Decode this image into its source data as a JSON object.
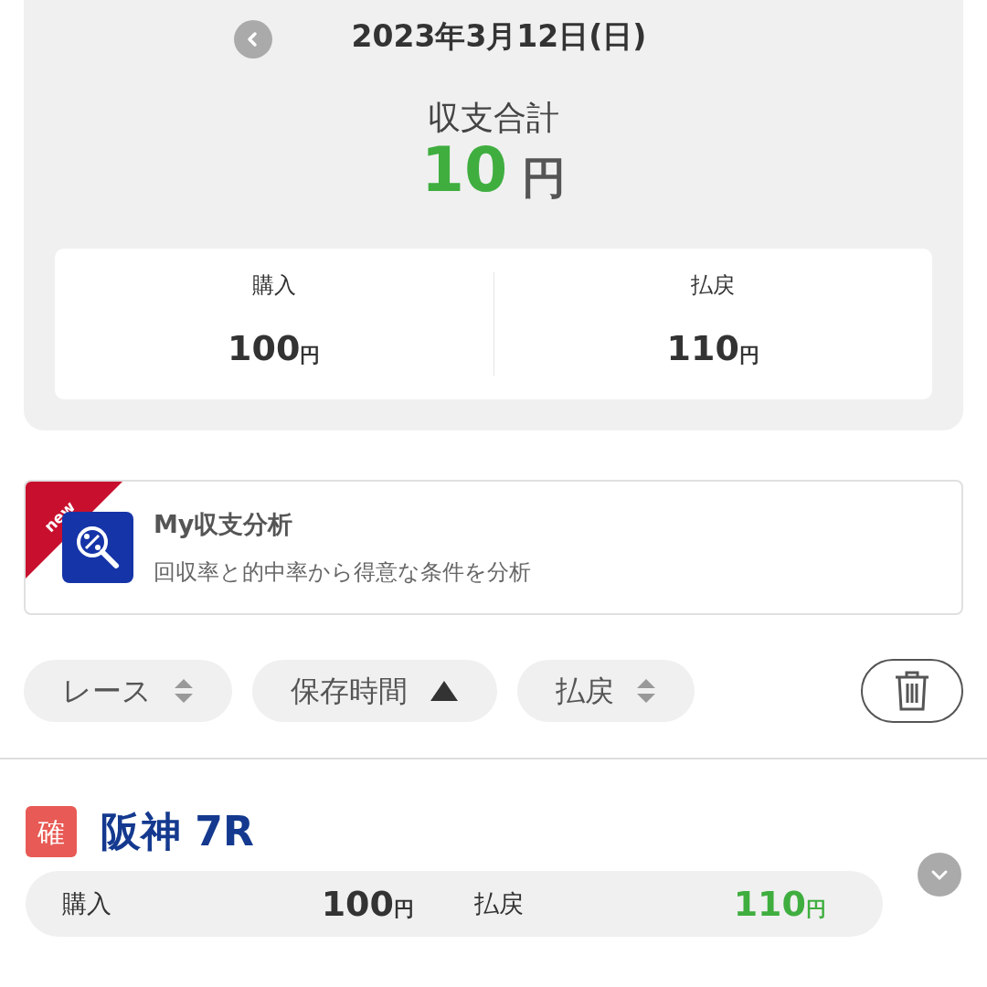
{
  "header": {
    "date": "2023年3月12日(日)"
  },
  "summary": {
    "label": "収支合計",
    "amount": "10",
    "unit": "円",
    "positive": true
  },
  "totals": [
    {
      "label": "購入",
      "amount": "100",
      "unit": "円"
    },
    {
      "label": "払戻",
      "amount": "110",
      "unit": "円"
    }
  ],
  "promo": {
    "badge": "new",
    "title": "My収支分析",
    "description": "回収率と的中率から得意な条件を分析"
  },
  "sort_buttons": [
    {
      "label": "レース",
      "selected": false
    },
    {
      "label": "保存時間",
      "selected": true
    },
    {
      "label": "払戻",
      "selected": false
    }
  ],
  "races": [
    {
      "status": "確",
      "name": "阪神 7R",
      "expanded": false,
      "purchase_label": "購入",
      "purchase": "100",
      "purchase_unit": "円",
      "payout_label": "払戻",
      "payout": "110",
      "payout_unit": "円",
      "hit": true
    }
  ]
}
